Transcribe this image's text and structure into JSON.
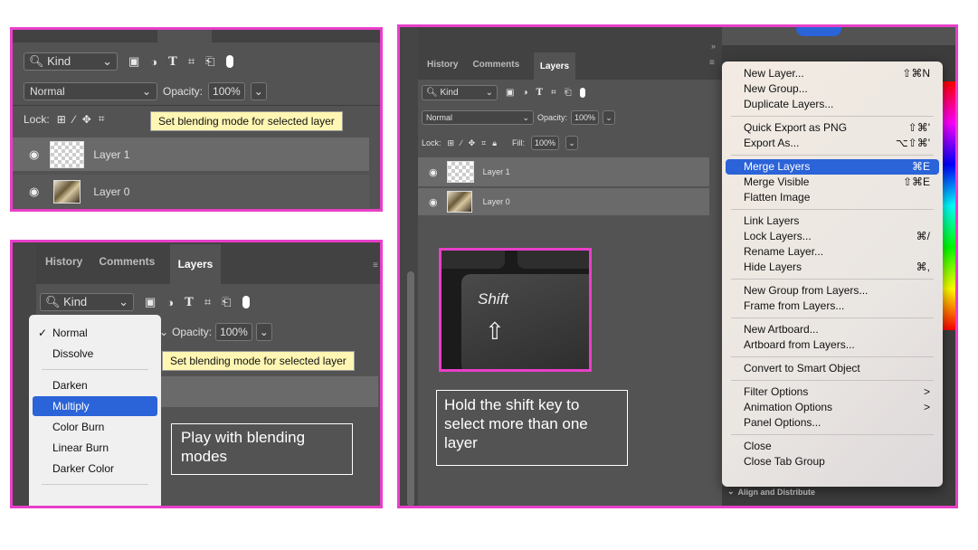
{
  "colors": {
    "frame": "#e83fc8",
    "panel": "#535353",
    "highlight": "#2b63d8"
  },
  "panel1": {
    "kind_label": "Kind",
    "blend_mode": "Normal",
    "opacity_label": "Opacity:",
    "opacity_value": "100%",
    "lock_label": "Lock:",
    "tooltip": "Set blending mode for selected layer",
    "layers": [
      "Layer 1",
      "Layer 0"
    ]
  },
  "panel2": {
    "tabs": [
      "History",
      "Comments",
      "Layers"
    ],
    "kind_label": "Kind",
    "opacity_label": "Opacity:",
    "opacity_value": "100%",
    "tooltip": "Set blending mode for selected layer",
    "blend_options": [
      {
        "label": "Normal",
        "checked": true
      },
      {
        "label": "Dissolve"
      },
      {
        "label": "Darken"
      },
      {
        "label": "Multiply",
        "selected": true
      },
      {
        "label": "Color Burn"
      },
      {
        "label": "Linear Burn"
      },
      {
        "label": "Darker Color"
      }
    ],
    "check": "✓",
    "caption": "Play with blending modes"
  },
  "panel3": {
    "tabs": [
      "History",
      "Comments",
      "Layers"
    ],
    "kind_label": "Kind",
    "blend_mode": "Normal",
    "opacity_label": "Opacity:",
    "opacity_value": "100%",
    "lock_label": "Lock:",
    "fill_label": "Fill:",
    "fill_value": "100%",
    "layers": [
      "Layer 1",
      "Layer 0"
    ],
    "key_label": "Shift",
    "caption": "Hold the shift key to select more than one layer",
    "menu": {
      "items": [
        {
          "label": "New Layer...",
          "shortcut": "⇧⌘N"
        },
        {
          "label": "New Group...",
          "shortcut": ""
        },
        {
          "label": "Duplicate Layers...",
          "shortcut": ""
        },
        {
          "sep": true
        },
        {
          "label": "Quick Export as PNG",
          "shortcut": "⇧⌘'"
        },
        {
          "label": "Export As...",
          "shortcut": "⌥⇧⌘'"
        },
        {
          "sep": true
        },
        {
          "label": "Merge Layers",
          "shortcut": "⌘E",
          "selected": true
        },
        {
          "label": "Merge Visible",
          "shortcut": "⇧⌘E"
        },
        {
          "label": "Flatten Image",
          "shortcut": ""
        },
        {
          "sep": true
        },
        {
          "label": "Link Layers",
          "shortcut": ""
        },
        {
          "label": "Lock Layers...",
          "shortcut": "⌘/"
        },
        {
          "label": "Rename Layer...",
          "shortcut": ""
        },
        {
          "label": "Hide Layers",
          "shortcut": "⌘,"
        },
        {
          "sep": true
        },
        {
          "label": "New Group from Layers...",
          "shortcut": ""
        },
        {
          "label": "Frame from Layers...",
          "shortcut": ""
        },
        {
          "sep": true
        },
        {
          "label": "New Artboard...",
          "shortcut": ""
        },
        {
          "label": "Artboard from Layers...",
          "shortcut": ""
        },
        {
          "sep": true
        },
        {
          "label": "Convert to Smart Object",
          "shortcut": ""
        },
        {
          "sep": true
        },
        {
          "label": "Filter Options",
          "shortcut": ">"
        },
        {
          "label": "Animation Options",
          "shortcut": ">"
        },
        {
          "label": "Panel Options...",
          "shortcut": ""
        },
        {
          "sep": true
        },
        {
          "label": "Close",
          "shortcut": ""
        },
        {
          "label": "Close Tab Group",
          "shortcut": ""
        }
      ]
    },
    "align_label": "Align and Distribute"
  }
}
